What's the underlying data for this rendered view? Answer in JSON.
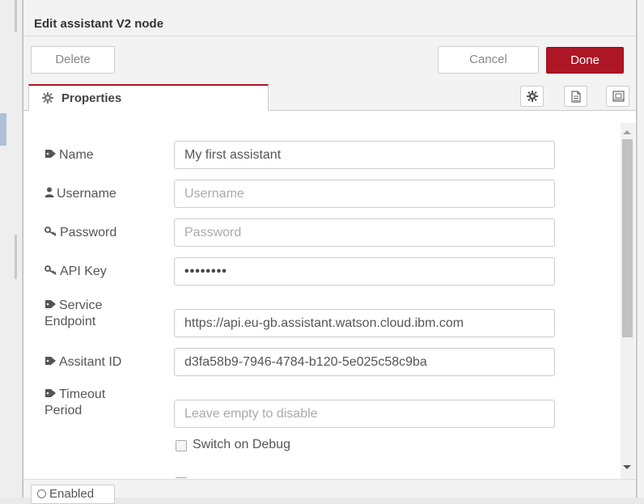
{
  "dialog": {
    "title": "Edit assistant V2 node",
    "delete_label": "Delete",
    "cancel_label": "Cancel",
    "done_label": "Done"
  },
  "tabs": {
    "properties_label": "Properties"
  },
  "form": {
    "name": {
      "label": "Name",
      "value": "My first assistant",
      "placeholder": ""
    },
    "username": {
      "label": "Username",
      "value": "",
      "placeholder": "Username"
    },
    "password": {
      "label": "Password",
      "value": "",
      "placeholder": "Password"
    },
    "api_key": {
      "label": "API Key",
      "value": "••••••••",
      "placeholder": ""
    },
    "service_endpoint": {
      "label_line1": "Service",
      "label_line2": "Endpoint",
      "value": "https://api.eu-gb.assistant.watson.cloud.ibm.com",
      "placeholder": ""
    },
    "assistant_id": {
      "label": "Assitant ID",
      "value": "d3fa58b9-7946-4784-b120-5e025c58c9ba",
      "placeholder": ""
    },
    "timeout_period": {
      "label_line1": "Timeout",
      "label_line2": "Period",
      "value": "",
      "placeholder": "Leave empty to disable"
    },
    "debug": {
      "label": "Switch on Debug",
      "checked": false
    }
  },
  "footer": {
    "enabled_label": "Enabled"
  },
  "icons": {
    "tag": "tag-icon",
    "user": "user-icon",
    "key": "key-icon",
    "gear": "gear-icon",
    "description": "document-icon",
    "appearance": "appearance-icon"
  },
  "colors": {
    "done": "#ad1625",
    "tab_accent": "#ad1625",
    "panel": "#f3f3f3"
  }
}
